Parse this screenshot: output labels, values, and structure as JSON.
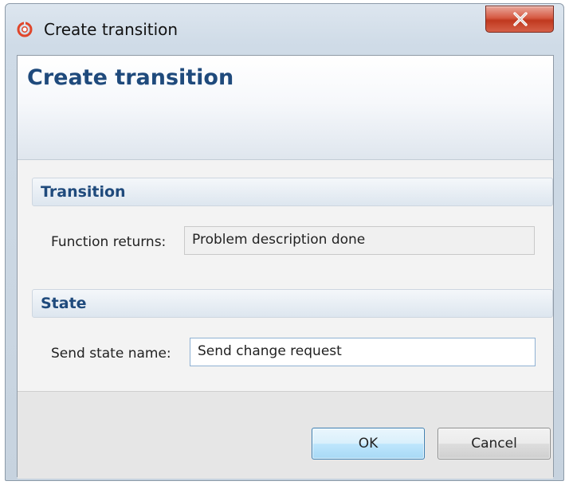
{
  "window": {
    "title": "Create transition",
    "close_glyph": "X"
  },
  "banner": {
    "title": "Create transition"
  },
  "sections": {
    "transition": {
      "header": "Transition",
      "field_label": "Function returns:",
      "field_value": "Problem description done"
    },
    "state": {
      "header": "State",
      "field_label": "Send state name:",
      "field_value": "Send change request"
    }
  },
  "buttons": {
    "ok": "OK",
    "cancel": "Cancel"
  },
  "icons": {
    "app": "app-logo-icon",
    "close": "close-icon"
  },
  "colors": {
    "heading": "#1f4a7c",
    "close_button": "#c0391f",
    "logo": "#e0462b"
  }
}
